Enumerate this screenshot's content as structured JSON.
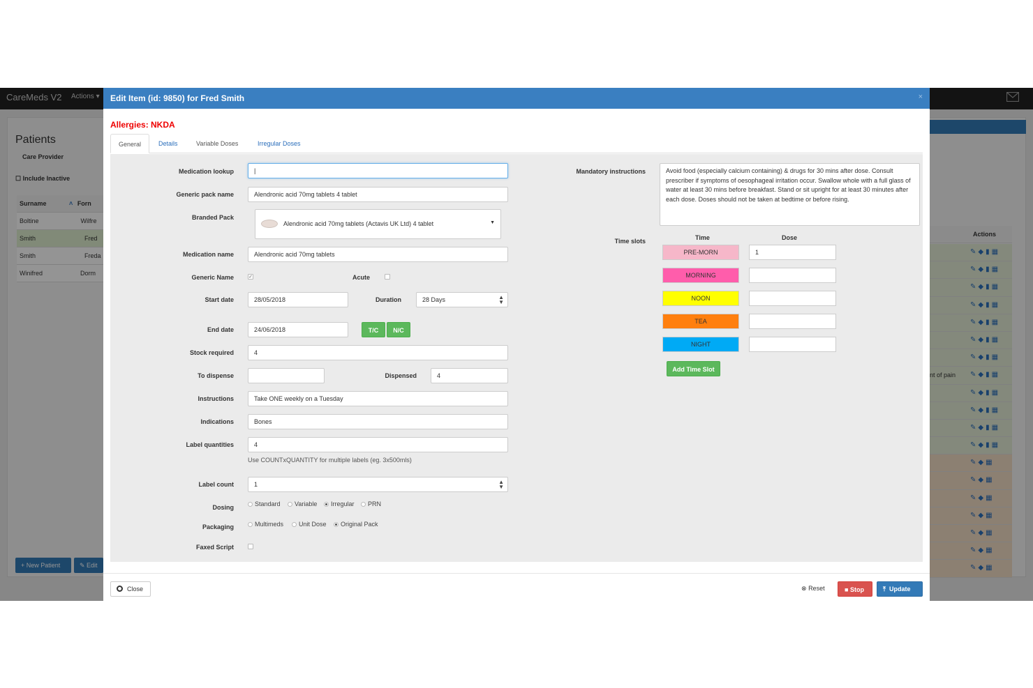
{
  "navbar": {
    "brand": "CareMeds V2",
    "actions": "Actions ▾"
  },
  "background": {
    "title": "Patients",
    "care_provider_label": "Care Provider",
    "include_inactive": "Include Inactive",
    "table_headers": [
      "Surname",
      "Forn"
    ],
    "rows": [
      {
        "surname": "Boltine",
        "forename": "Wilfre"
      },
      {
        "surname": "Smith",
        "forename": "Fred"
      },
      {
        "surname": "Smith",
        "forename": "Freda"
      },
      {
        "surname": "Winifred",
        "forename": "Dorm"
      }
    ],
    "actions_header": "Actions",
    "row_note": "nt of pain",
    "new_patient": "+ New Patient",
    "edit": "Edit"
  },
  "modal": {
    "title": "Edit Item (id: 9850) for Fred Smith",
    "close_x": "×",
    "allergies": "Allergies: NKDA",
    "tabs": [
      "General",
      "Details",
      "Variable Doses",
      "Irregular Doses"
    ]
  },
  "form": {
    "medication_lookup": {
      "label": "Medication lookup",
      "value": "|"
    },
    "generic_pack_name": {
      "label": "Generic pack name",
      "value": "Alendronic acid 70mg tablets 4 tablet"
    },
    "branded_pack": {
      "label": "Branded Pack",
      "value": "Alendronic acid 70mg tablets (Actavis UK Ltd) 4 tablet"
    },
    "medication_name": {
      "label": "Medication name",
      "value": "Alendronic acid 70mg tablets"
    },
    "generic_name": {
      "label": "Generic Name",
      "checked": true
    },
    "acute": {
      "label": "Acute",
      "checked": false
    },
    "start_date": {
      "label": "Start date",
      "value": "28/05/2018"
    },
    "duration": {
      "label": "Duration",
      "value": "28 Days"
    },
    "end_date": {
      "label": "End date",
      "value": "24/06/2018"
    },
    "tc_button": "T/C",
    "nc_button": "N/C",
    "stock_required": {
      "label": "Stock required",
      "value": "4"
    },
    "to_dispense": {
      "label": "To dispense",
      "value": ""
    },
    "dispensed": {
      "label": "Dispensed",
      "value": "4"
    },
    "instructions": {
      "label": "Instructions",
      "value": "Take ONE weekly on a Tuesday"
    },
    "indications": {
      "label": "Indications",
      "value": "Bones"
    },
    "label_quantities": {
      "label": "Label quantities",
      "value": "4",
      "help": "Use COUNTxQUANTITY for multiple labels (eg. 3x500mls)"
    },
    "label_count": {
      "label": "Label count",
      "value": "1"
    },
    "dosing": {
      "label": "Dosing",
      "options": [
        "Standard",
        "Variable",
        "Irregular",
        "PRN"
      ],
      "selected": "Irregular"
    },
    "packaging": {
      "label": "Packaging",
      "options": [
        "Multimeds",
        "Unit Dose",
        "Original Pack"
      ],
      "selected": "Original Pack"
    },
    "faxed_script": {
      "label": "Faxed Script",
      "checked": false
    },
    "mandatory_instructions": {
      "label": "Mandatory instructions",
      "value": "Avoid food (especially calcium containing) & drugs for 30 mins after dose. Consult prescriber if symptoms of oesophageal irritation occur. Swallow whole with a full glass of water at least 30 mins before breakfast. Stand or sit upright for at least 30 minutes after each dose. Doses should not be taken at bedtime or before rising."
    },
    "time_slots": {
      "label": "Time slots",
      "time_header": "Time",
      "dose_header": "Dose",
      "slots": [
        {
          "name": "PRE-MORN",
          "color": "#f6b7c9",
          "dose": "1"
        },
        {
          "name": "MORNING",
          "color": "#ff5dab",
          "dose": ""
        },
        {
          "name": "NOON",
          "color": "#ffff00",
          "dose": ""
        },
        {
          "name": "TEA",
          "color": "#ff7f0e",
          "dose": ""
        },
        {
          "name": "NIGHT",
          "color": "#00aaf5",
          "dose": ""
        }
      ],
      "add_button": "Add Time Slot"
    }
  },
  "footer": {
    "close": "Close",
    "reset": "Reset",
    "stop": "Stop",
    "update": "Update"
  }
}
